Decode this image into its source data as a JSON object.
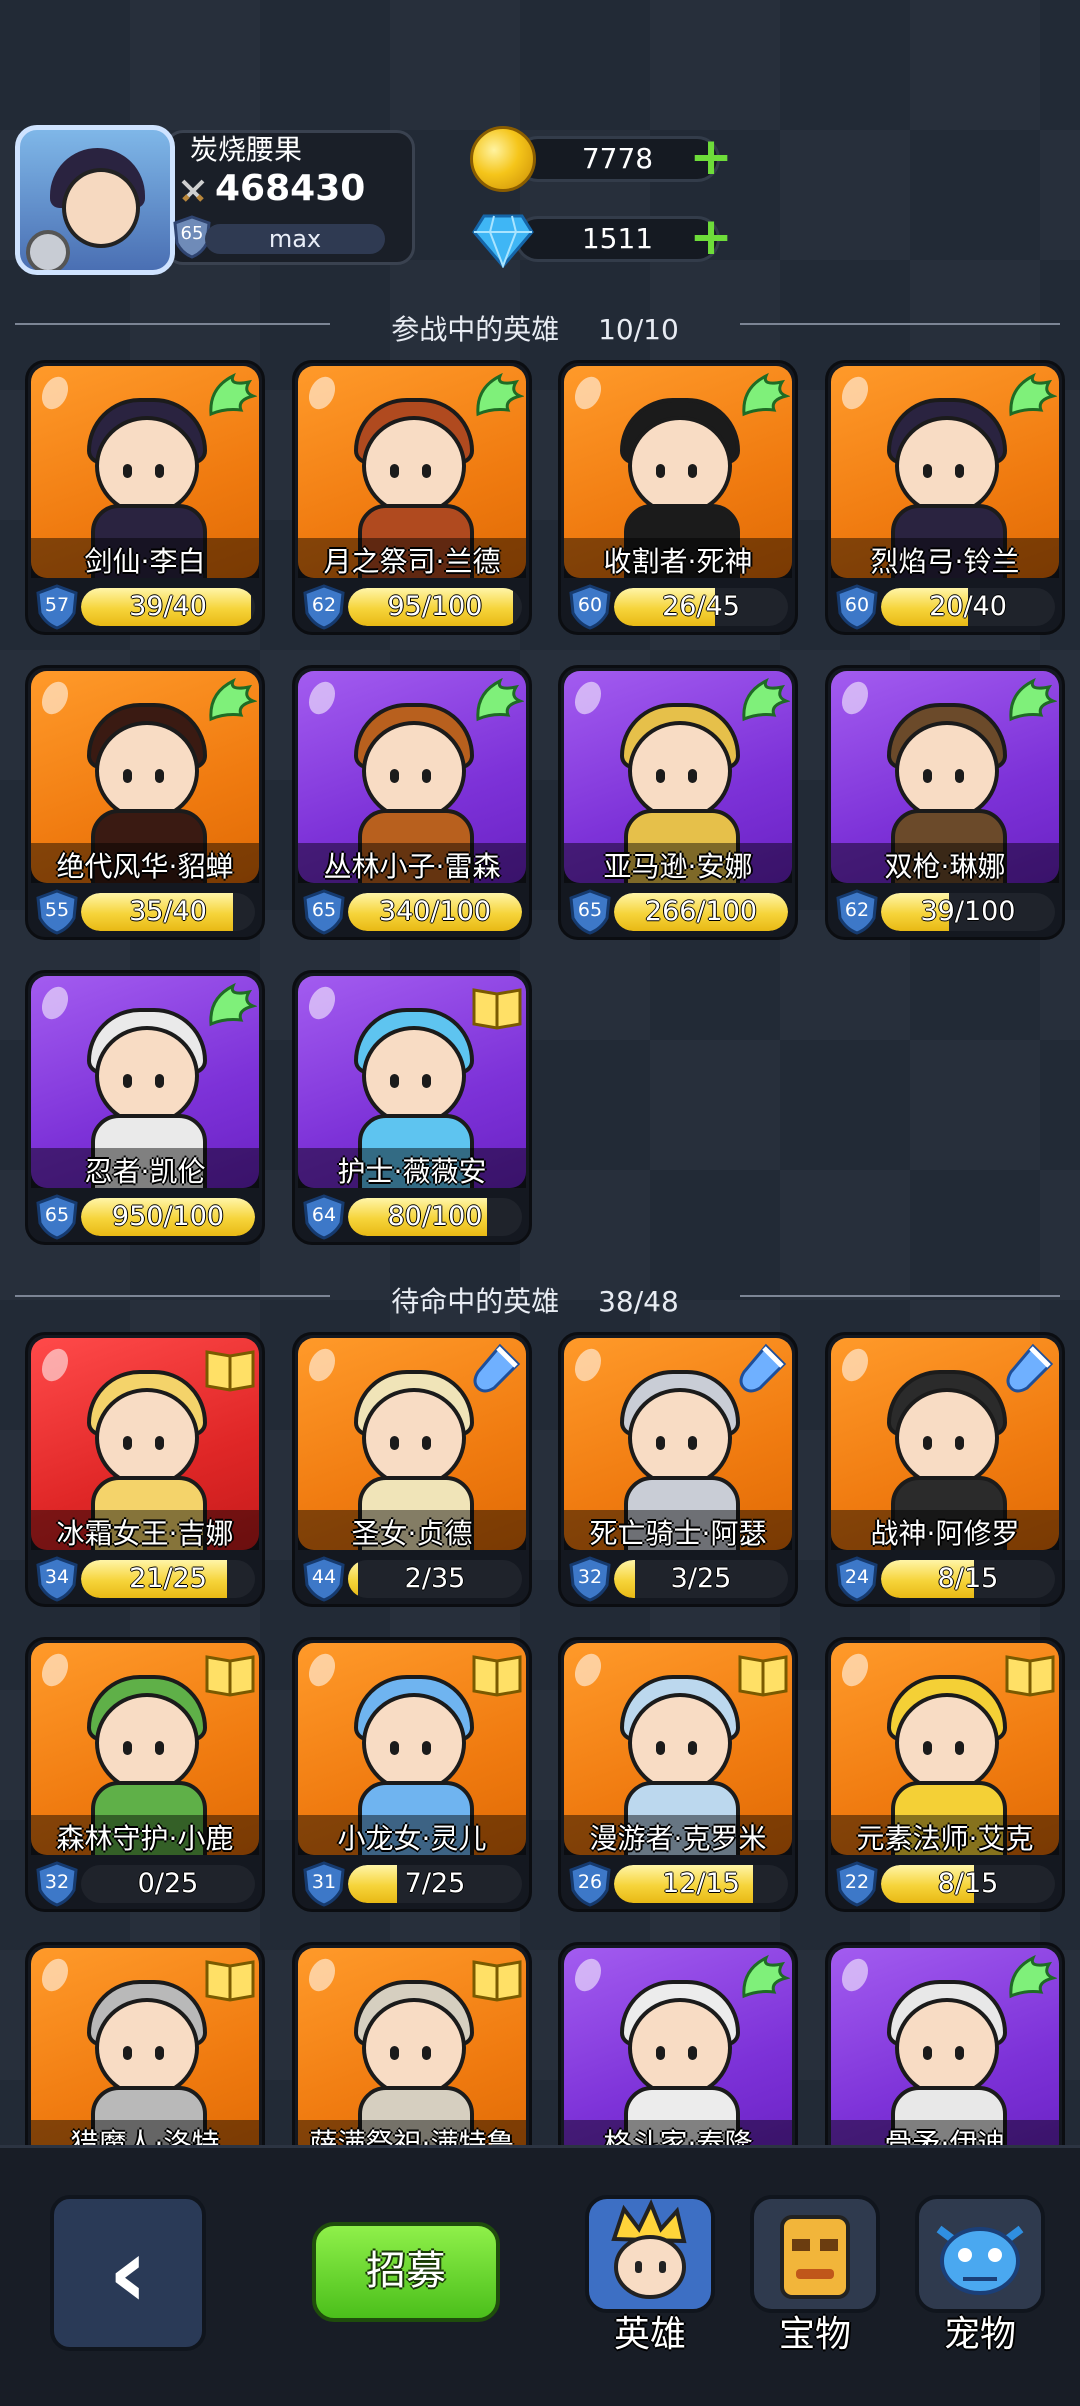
{
  "player": {
    "name": "炭烧腰果",
    "power": "468430",
    "level": "65",
    "level_status": "max"
  },
  "resources": {
    "gold": "7778",
    "gems": "1511"
  },
  "sections": {
    "active": {
      "title": "参战中的英雄",
      "count": "10/10"
    },
    "standby": {
      "title": "待命中的英雄",
      "count": "38/48"
    }
  },
  "active_heroes": [
    {
      "name": "剑仙·李白",
      "level": "57",
      "progress": "39/40",
      "frac": 0.975,
      "bg": "orange",
      "badge": "wing"
    },
    {
      "name": "月之祭司·兰德",
      "level": "62",
      "progress": "95/100",
      "frac": 0.95,
      "bg": "orange",
      "badge": "wing"
    },
    {
      "name": "收割者·死神",
      "level": "60",
      "progress": "26/45",
      "frac": 0.578,
      "bg": "orange",
      "badge": "wing"
    },
    {
      "name": "烈焰弓·铃兰",
      "level": "60",
      "progress": "20/40",
      "frac": 0.5,
      "bg": "orange",
      "badge": "wing"
    },
    {
      "name": "绝代风华·貂蝉",
      "level": "55",
      "progress": "35/40",
      "frac": 0.875,
      "bg": "orange",
      "badge": "wing"
    },
    {
      "name": "丛林小子·雷森",
      "level": "65",
      "progress": "340/100",
      "frac": 1,
      "bg": "purple",
      "badge": "wing"
    },
    {
      "name": "亚马逊·安娜",
      "level": "65",
      "progress": "266/100",
      "frac": 1,
      "bg": "purple",
      "badge": "wing"
    },
    {
      "name": "双枪·琳娜",
      "level": "62",
      "progress": "39/100",
      "frac": 0.39,
      "bg": "purple",
      "badge": "wing"
    },
    {
      "name": "忍者·凯伦",
      "level": "65",
      "progress": "950/100",
      "frac": 1,
      "bg": "purple",
      "badge": "wing"
    },
    {
      "name": "护士·薇薇安",
      "level": "64",
      "progress": "80/100",
      "frac": 0.8,
      "bg": "purple",
      "badge": "book"
    }
  ],
  "standby_heroes": [
    {
      "name": "冰霜女王·吉娜",
      "level": "34",
      "progress": "21/25",
      "frac": 0.84,
      "bg": "red",
      "badge": "book"
    },
    {
      "name": "圣女·贞德",
      "level": "44",
      "progress": "2/35",
      "frac": 0.057,
      "bg": "orange",
      "badge": "potion"
    },
    {
      "name": "死亡骑士·阿瑟",
      "level": "32",
      "progress": "3/25",
      "frac": 0.12,
      "bg": "orange",
      "badge": "potion"
    },
    {
      "name": "战神·阿修罗",
      "level": "24",
      "progress": "8/15",
      "frac": 0.533,
      "bg": "orange",
      "badge": "potion"
    },
    {
      "name": "森林守护·小鹿",
      "level": "32",
      "progress": "0/25",
      "frac": 0,
      "bg": "orange",
      "badge": "book"
    },
    {
      "name": "小龙女·灵儿",
      "level": "31",
      "progress": "7/25",
      "frac": 0.28,
      "bg": "orange",
      "badge": "book"
    },
    {
      "name": "漫游者·克罗米",
      "level": "26",
      "progress": "12/15",
      "frac": 0.8,
      "bg": "orange",
      "badge": "book"
    },
    {
      "name": "元素法师·艾克",
      "level": "22",
      "progress": "8/15",
      "frac": 0.533,
      "bg": "orange",
      "badge": "book"
    },
    {
      "name": "猎魔人·洛特",
      "level": "",
      "progress": "",
      "frac": 0,
      "bg": "orange",
      "badge": "book"
    },
    {
      "name": "萨满祭祀·满特鲁",
      "level": "",
      "progress": "",
      "frac": 0,
      "bg": "orange",
      "badge": "book"
    },
    {
      "name": "格斗家·泰隆",
      "level": "",
      "progress": "",
      "frac": 0,
      "bg": "purple",
      "badge": "wing"
    },
    {
      "name": "骨矛·伊迪",
      "level": "",
      "progress": "",
      "frac": 0,
      "bg": "purple",
      "badge": "wing"
    }
  ],
  "nav": {
    "recruit": "招募",
    "heroes": "英雄",
    "treasure": "宝物",
    "pets": "宠物"
  },
  "icons": {
    "back": "back-arrow-icon",
    "gold": "gold-coin-icon",
    "gem": "diamond-icon",
    "wing": "green-wing-icon",
    "book": "book-icon",
    "potion": "potion-icon"
  }
}
